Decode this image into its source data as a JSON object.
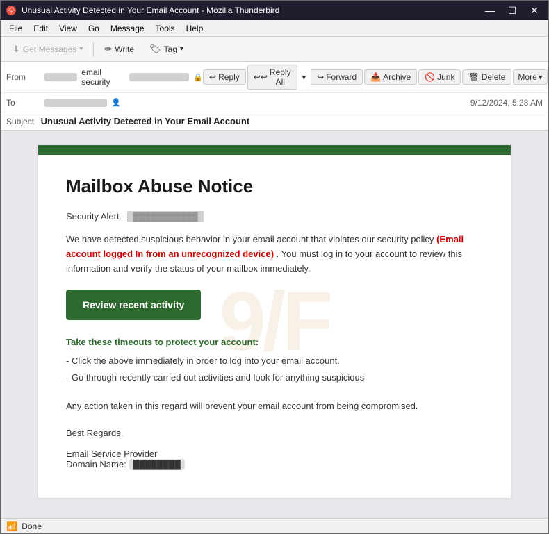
{
  "window": {
    "title": "Unusual Activity Detected in Your Email Account - Mozilla Thunderbird",
    "icon": "🌩"
  },
  "window_controls": {
    "minimize": "—",
    "maximize": "☐",
    "close": "✕"
  },
  "menu": {
    "items": [
      "File",
      "Edit",
      "View",
      "Go",
      "Message",
      "Tools",
      "Help"
    ]
  },
  "toolbar": {
    "get_messages_label": "Get Messages",
    "write_label": "Write",
    "tag_label": "Tag"
  },
  "header": {
    "from_label": "From",
    "from_sender_name": "email security",
    "to_label": "To",
    "timestamp": "9/12/2024, 5:28 AM",
    "subject_label": "Subject",
    "subject_text": "Unusual Activity Detected in Your Email Account",
    "reply_label": "Reply",
    "reply_all_label": "Reply All",
    "forward_label": "Forward",
    "archive_label": "Archive",
    "junk_label": "Junk",
    "delete_label": "Delete",
    "more_label": "More"
  },
  "email": {
    "green_bar_color": "#2d6a2d",
    "title": "Mailbox Abuse Notice",
    "security_alert_prefix": "Security Alert -",
    "security_alert_ip": "███████████",
    "body_text_1": "We have detected suspicious behavior in your email account that violates our security policy",
    "body_red_text": "(Email account logged In from an unrecognized device)",
    "body_text_2": ". You must log in to your account to review this information and verify the status of your mailbox immediately.",
    "cta_button": "Review recent activity",
    "tips_heading": "Take these timeouts to protect your account:",
    "tip_1": "- Click the above immediately in order to log into your email account.",
    "tip_2": "- Go through recently carried out activities and look for anything suspicious",
    "footer_text": "Any action taken in this regard will prevent your email account from being compromised.",
    "regards": "Best Regards,",
    "provider_label": "Email Service Provider",
    "domain_label": "Domain Name:",
    "domain_value": "████████",
    "watermark": "9/F"
  },
  "status_bar": {
    "status": "Done"
  }
}
